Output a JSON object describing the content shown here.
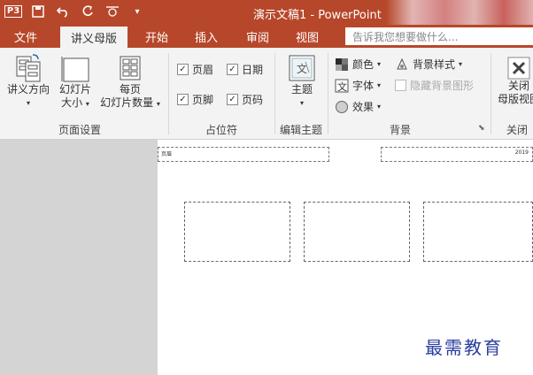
{
  "window": {
    "title": "演示文稿1 - PowerPoint",
    "app_badge": "P3"
  },
  "tabs": [
    {
      "label": "文件",
      "active": false
    },
    {
      "label": "讲义母版",
      "active": true
    },
    {
      "label": "开始",
      "active": false
    },
    {
      "label": "插入",
      "active": false
    },
    {
      "label": "审阅",
      "active": false
    },
    {
      "label": "视图",
      "active": false
    }
  ],
  "search": {
    "placeholder": "告诉我您想要做什么..."
  },
  "ribbon": {
    "page_setup": {
      "label": "页面设置",
      "orientation": "讲义方向",
      "slide_size_line1": "幻灯片",
      "slide_size_line2": "大小",
      "per_page_line1": "每页",
      "per_page_line2": "幻灯片数量"
    },
    "placeholders": {
      "label": "占位符",
      "header": "页眉",
      "date": "日期",
      "footer": "页脚",
      "page_number": "页码"
    },
    "edit_theme": {
      "label": "编辑主题",
      "theme": "主题"
    },
    "background": {
      "label": "背景",
      "colors": "颜色",
      "bg_styles": "背景样式",
      "fonts": "字体",
      "hide_bg": "隐藏背景图形",
      "effects": "效果"
    },
    "close": {
      "label": "关闭",
      "line1": "关闭",
      "line2": "母版视图"
    }
  },
  "slide": {
    "header_text": "页眉",
    "date_text": "2019"
  },
  "watermark": "最需教育",
  "colors": {
    "accent": "#b7472a",
    "ribbon_bg": "#f3f3f3",
    "workspace": "#d4d4d4"
  }
}
